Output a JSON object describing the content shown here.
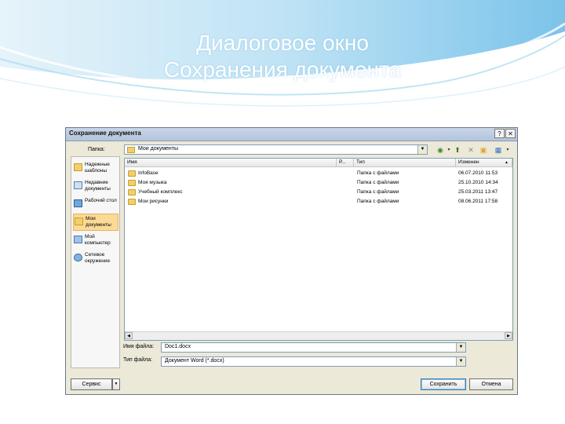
{
  "slide": {
    "title_line1": "Диалоговое окно",
    "title_line2": "Сохранения документа"
  },
  "dialog": {
    "title": "Сохранение документа",
    "help_button": "?",
    "close_button": "✕",
    "folder_label": "Папка:",
    "folder_value": "Мои документы",
    "places": [
      {
        "label": "Надежные шаблоны",
        "icon": "trusted-templates-icon"
      },
      {
        "label": "Недавние документы",
        "icon": "recent-documents-icon"
      },
      {
        "label": "Рабочий стол",
        "icon": "desktop-icon"
      },
      {
        "label": "Мои документы",
        "icon": "my-documents-icon",
        "selected": true
      },
      {
        "label": "Мой компьютер",
        "icon": "my-computer-icon"
      },
      {
        "label": "Сетевое окружение",
        "icon": "network-icon"
      }
    ],
    "columns": [
      "Имя",
      "Р...",
      "Тип",
      "Изменен"
    ],
    "files": [
      {
        "name": "InfoBase",
        "type": "Папка с файлами",
        "modified": "06.07.2010 11:53"
      },
      {
        "name": "Моя музыка",
        "type": "Папка с файлами",
        "modified": "25.10.2010 14:34"
      },
      {
        "name": "Учебный комплекс",
        "type": "Папка с файлами",
        "modified": "25.03.2011 13:47"
      },
      {
        "name": "Мои рисунки",
        "type": "Папка с файлами",
        "modified": "08.06.2011 17:58"
      }
    ],
    "filename_label": "Имя файла:",
    "filename_value": "Doc1.docx",
    "filetype_label": "Тип файла:",
    "filetype_value": "Документ Word (*.docx)",
    "tools_button": "Сервис",
    "save_button": "Сохранить",
    "cancel_button": "Отмена"
  }
}
